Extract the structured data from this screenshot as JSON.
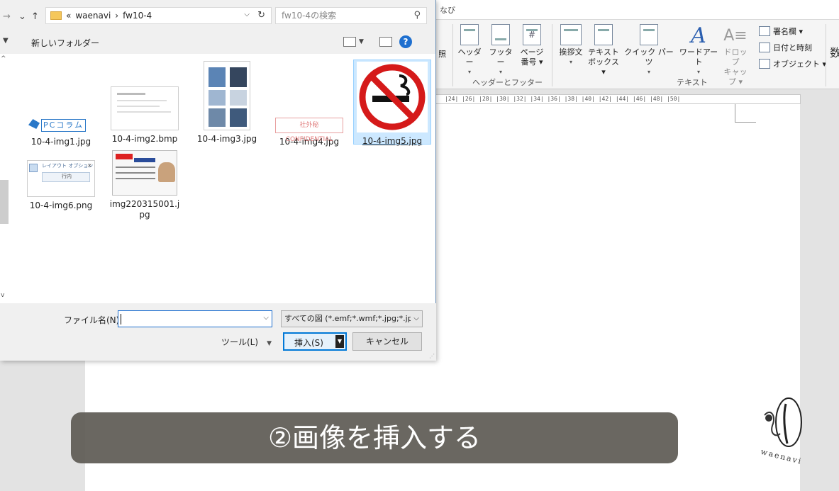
{
  "word": {
    "tab_partial": "なび",
    "ribbon": {
      "items": [
        {
          "label": "照",
          "sub": ""
        },
        {
          "label": "ヘッダー",
          "sub": "▾"
        },
        {
          "label": "フッター",
          "sub": "▾"
        },
        {
          "label": "ページ",
          "sub": "番号 ▾"
        },
        {
          "label": "挨拶文",
          "sub": "▾"
        },
        {
          "label": "テキスト",
          "sub": "ボックス ▾"
        },
        {
          "label": "クイック",
          "sub": "▾"
        },
        {
          "label": "パーツ",
          "sub": ""
        },
        {
          "label": "ワードアート",
          "sub": "▾"
        },
        {
          "label": "ドロップ",
          "sub": "キャップ ▾"
        }
      ],
      "small_items": [
        {
          "label": "署名欄 ▾",
          "icon": "signature-icon"
        },
        {
          "label": "日付と時刻",
          "icon": "date-time-icon"
        },
        {
          "label": "オブジェクト ▾",
          "icon": "object-icon"
        }
      ],
      "groups": [
        "ヘッダーとフッター",
        "テキスト"
      ],
      "edge_glyph": "数"
    },
    "ruler": "|24|  |26|  |28|  |30|  |32|  |34|  |36|  |38|  |40|  |42|  |44|  |46|  |48|  |50|",
    "logo_text": "waenavi"
  },
  "caption": "②画像を挿入する",
  "dialog": {
    "nav": {
      "back": "→",
      "up": "↑"
    },
    "address": {
      "prefix": "«",
      "path1": "waenavi",
      "sep": "›",
      "path2": "fw10-4"
    },
    "search_placeholder": "fw10-4の検索",
    "new_folder": "新しいフォルダー",
    "files": [
      {
        "name": "10-4-img1.jpg",
        "selected": false
      },
      {
        "name": "10-4-img2.bmp",
        "selected": false
      },
      {
        "name": "10-4-img3.jpg",
        "selected": false
      },
      {
        "name": "10-4-img4.jpg",
        "selected": false
      },
      {
        "name": "10-4-img5.jpg",
        "selected": true
      },
      {
        "name": "10-4-img6.png",
        "selected": false
      },
      {
        "name": "img220315001.jpg",
        "selected": false
      }
    ],
    "thumb_text": {
      "pc_column": "PCコラム",
      "confidential": "社外秘 CONFIDENTIAL",
      "layout_options": "レイアウト オプション",
      "layout_inline": "行内"
    },
    "filename_label": "ファイル名(N):",
    "filename_value": "",
    "filter": "すべての図 (*.emf;*.wmf;*.jpg;*.jp",
    "tools_label": "ツール(L)",
    "insert_label": "挿入(S)",
    "cancel_label": "キャンセル"
  }
}
